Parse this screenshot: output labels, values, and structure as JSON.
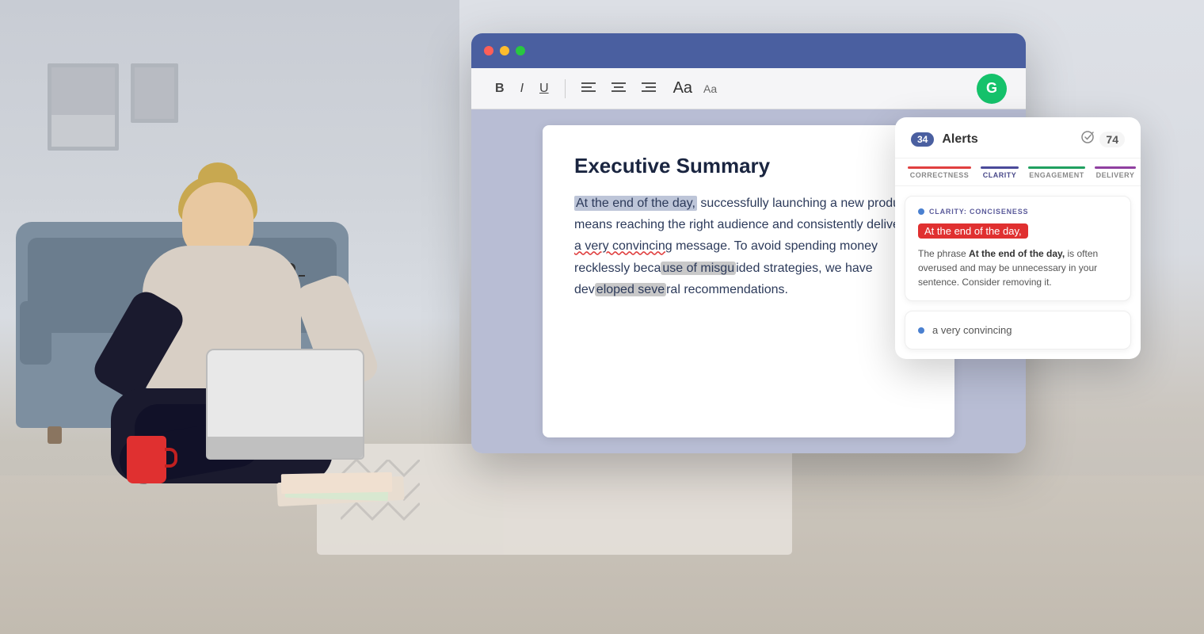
{
  "background": {
    "wall_color": "#dde0e6",
    "floor_color": "#c8c0b0"
  },
  "editor_window": {
    "titlebar_color": "#4a5fa0",
    "toolbar_buttons": {
      "bold": "B",
      "italic": "I",
      "underline": "U",
      "align_left": "≡",
      "align_center": "≡",
      "align_right": "≡",
      "font_large": "Aa",
      "font_small": "Aa"
    },
    "document": {
      "title": "Executive Summary",
      "body_text": "At the end of the day, successfully launching a new product means reaching the right audience and consistently delivering a very convincing message. To avoid spending money recklessly because of misguided strategies, we have developed several recommendations.",
      "highlighted": "At the end of the day,",
      "underlined": "a very convincing"
    }
  },
  "grammarly_panel": {
    "logo_letter": "G",
    "alerts_count": "34",
    "alerts_label": "Alerts",
    "score": "74",
    "tabs": [
      {
        "label": "CORRECTNESS",
        "color": "#e04040",
        "active": false
      },
      {
        "label": "CLARITY",
        "color": "#4a4a9a",
        "active": true
      },
      {
        "label": "ENGAGEMENT",
        "color": "#20a060",
        "active": false
      },
      {
        "label": "DELIVERY",
        "color": "#9040a0",
        "active": false
      }
    ],
    "alert_card": {
      "dot_color": "#4a80d0",
      "type_label": "CLARITY: CONCISENESS",
      "highlighted_text": "At the end of the day,",
      "description_intro": "The phrase ",
      "description_bold": "At the end of the day,",
      "description_rest": " is often overused and may be unnecessary in your sentence. Consider removing it."
    },
    "suggestion_card": {
      "dot_color": "#4a80d0",
      "text": "a very convincing"
    }
  }
}
